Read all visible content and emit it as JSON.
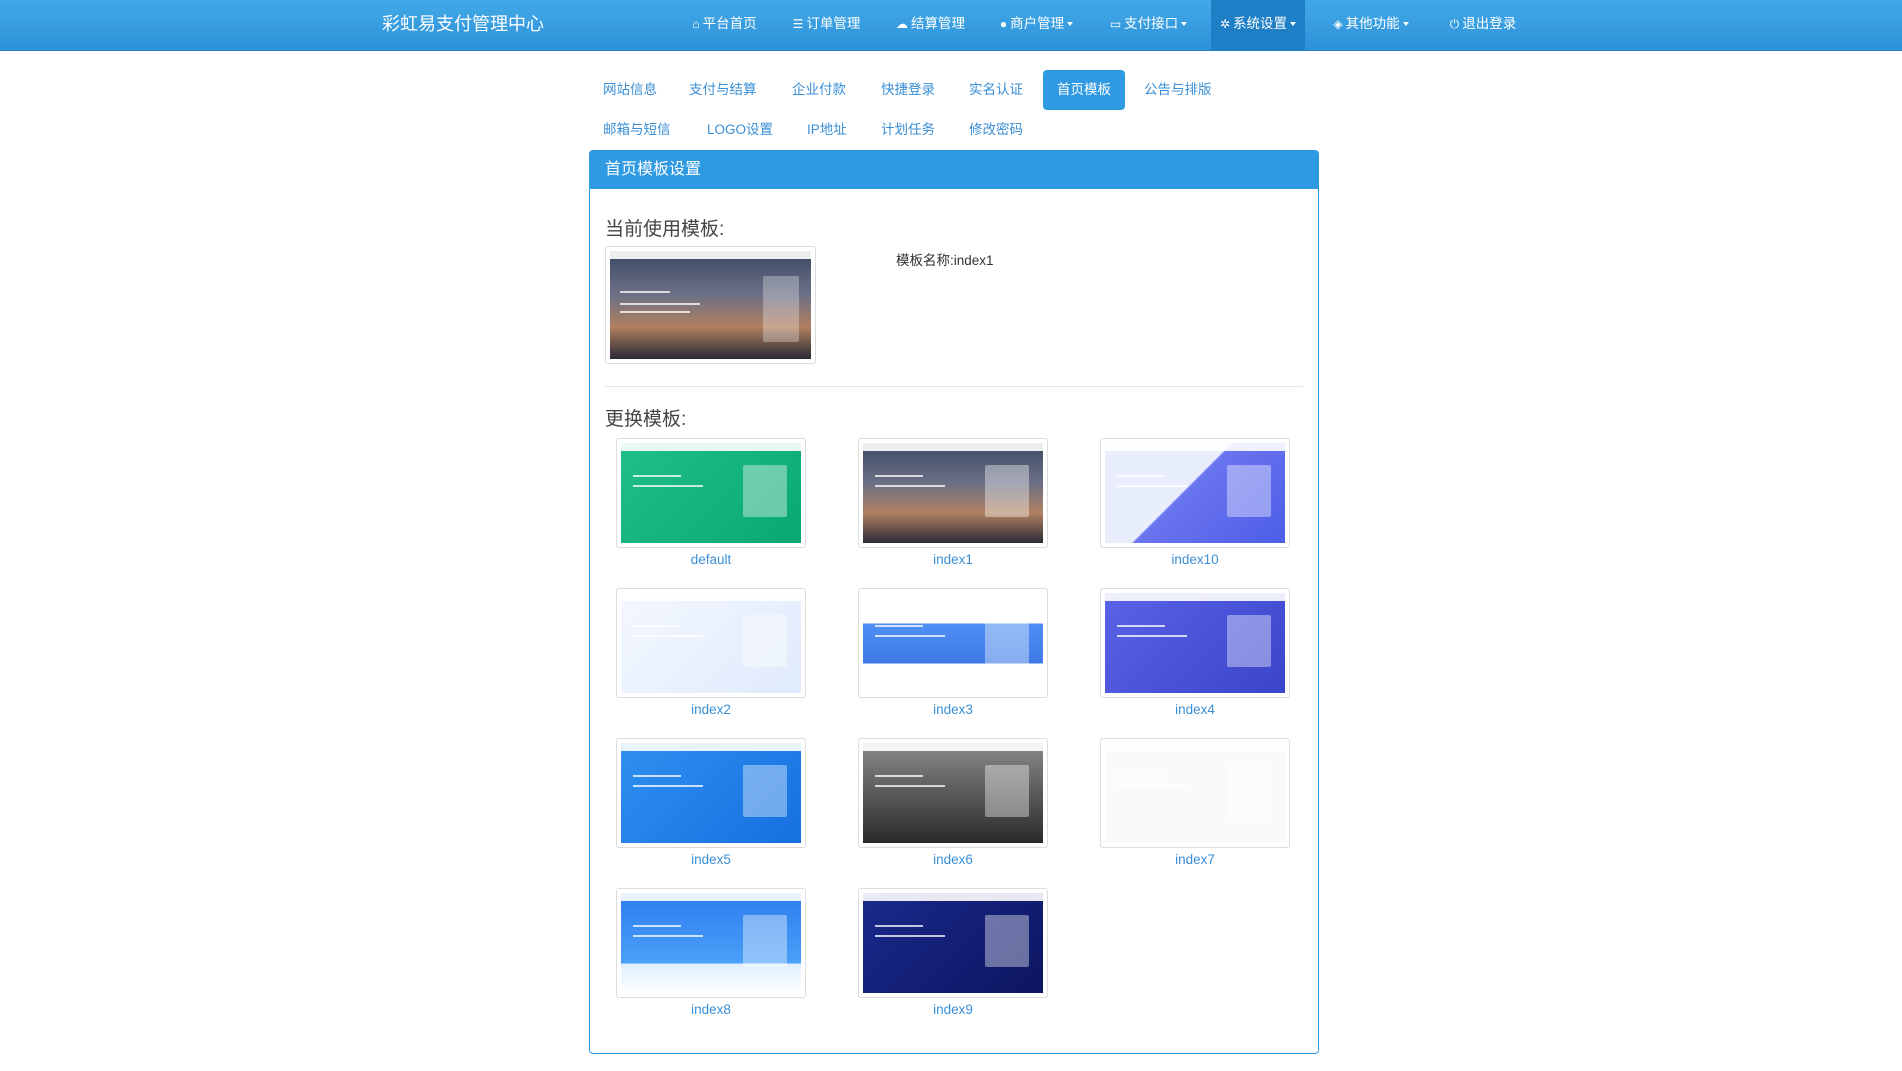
{
  "header": {
    "brand": "彩虹易支付管理中心",
    "nav": [
      {
        "icon": "home-icon",
        "glyph": "⌂",
        "label": "平台首页",
        "dropdown": false,
        "active": false
      },
      {
        "icon": "list-icon",
        "glyph": "☰",
        "label": "订单管理",
        "dropdown": false,
        "active": false
      },
      {
        "icon": "cloud-icon",
        "glyph": "☁",
        "label": "结算管理",
        "dropdown": false,
        "active": false
      },
      {
        "icon": "user-icon",
        "glyph": "●",
        "label": "商户管理",
        "dropdown": true,
        "active": false
      },
      {
        "icon": "credit-card-icon",
        "glyph": "▭",
        "label": "支付接口",
        "dropdown": true,
        "active": false
      },
      {
        "icon": "gear-icon",
        "glyph": "✲",
        "label": "系统设置",
        "dropdown": true,
        "active": true
      },
      {
        "icon": "cube-icon",
        "glyph": "◈",
        "label": "其他功能",
        "dropdown": true,
        "active": false
      },
      {
        "icon": "power-icon",
        "glyph": "⏻",
        "label": "退出登录",
        "dropdown": false,
        "active": false
      }
    ]
  },
  "tabs": [
    {
      "label": "网站信息",
      "active": false
    },
    {
      "label": "支付与结算",
      "active": false
    },
    {
      "label": "企业付款",
      "active": false
    },
    {
      "label": "快捷登录",
      "active": false
    },
    {
      "label": "实名认证",
      "active": false
    },
    {
      "label": "首页模板",
      "active": true
    },
    {
      "label": "公告与排版",
      "active": false
    },
    {
      "label": "邮箱与短信",
      "active": false
    },
    {
      "label": "LOGO设置",
      "active": false
    },
    {
      "label": "IP地址",
      "active": false
    },
    {
      "label": "计划任务",
      "active": false
    },
    {
      "label": "修改密码",
      "active": false
    }
  ],
  "panel": {
    "heading": "首页模板设置",
    "current_title": "当前使用模板:",
    "current_name_label": "模板名称:",
    "current_name_value": "index1",
    "change_title": "更换模板:"
  },
  "templates": [
    {
      "name": "default",
      "style": "s-green"
    },
    {
      "name": "index1",
      "style": "s-city"
    },
    {
      "name": "index10",
      "style": "s-purple"
    },
    {
      "name": "index2",
      "style": "s-iso"
    },
    {
      "name": "index3",
      "style": "s-blue3"
    },
    {
      "name": "index4",
      "style": "s-indigo"
    },
    {
      "name": "index5",
      "style": "s-blue5"
    },
    {
      "name": "index6",
      "style": "s-bw"
    },
    {
      "name": "index7",
      "style": "s-white"
    },
    {
      "name": "index8",
      "style": "s-blue8"
    },
    {
      "name": "index9",
      "style": "s-navy"
    }
  ]
}
